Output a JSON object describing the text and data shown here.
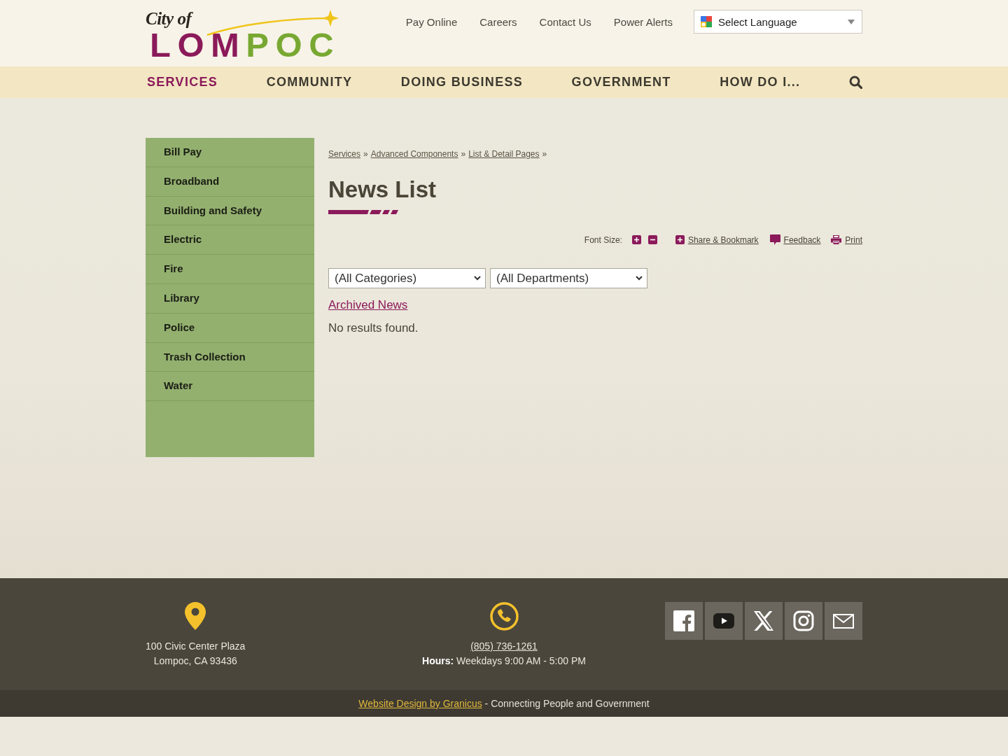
{
  "header": {
    "logo": {
      "script": "City of",
      "wordmark": "LOMPOC"
    },
    "utility_links": [
      "Pay Online",
      "Careers",
      "Contact Us",
      "Power Alerts"
    ],
    "language_select": {
      "value": "Select Language"
    }
  },
  "nav": {
    "items": [
      {
        "label": "SERVICES",
        "selected": true
      },
      {
        "label": "COMMUNITY",
        "selected": false
      },
      {
        "label": "DOING BUSINESS",
        "selected": false
      },
      {
        "label": "GOVERNMENT",
        "selected": false
      },
      {
        "label": "HOW DO I...",
        "selected": false
      }
    ]
  },
  "sidebar": {
    "items": [
      "Bill Pay",
      "Broadband",
      "Building and Safety",
      "Electric",
      "Fire",
      "Library",
      "Police",
      "Trash Collection",
      "Water"
    ]
  },
  "breadcrumb": [
    {
      "label": "Services",
      "separator": "»"
    },
    {
      "label": "Advanced Components",
      "separator": "»"
    },
    {
      "label": "List & Detail Pages",
      "separator": "»"
    }
  ],
  "page_title": "News List",
  "tools": {
    "font_size_label": "Font Size:",
    "share": "Share & Bookmark",
    "feedback": "Feedback",
    "print": "Print"
  },
  "filters": [
    {
      "value": "(All Categories)"
    },
    {
      "value": "(All Departments)"
    }
  ],
  "archived_link": "Archived News",
  "empty_message": "No results found.",
  "footer": {
    "address": [
      "100 Civic Center Plaza",
      "Lompoc, CA 93436"
    ],
    "phone": "(805) 736-1261",
    "hours": "**Hours:** Weekdays 9:00 AM - 5:00 PM",
    "social": [
      {
        "kind": "facebook"
      },
      {
        "kind": "youtube"
      },
      {
        "kind": "x"
      },
      {
        "kind": "instagram"
      },
      {
        "kind": "email"
      }
    ],
    "credit_link": "Website Design by Granicus",
    "credit_text": "- Connecting People and Government"
  }
}
